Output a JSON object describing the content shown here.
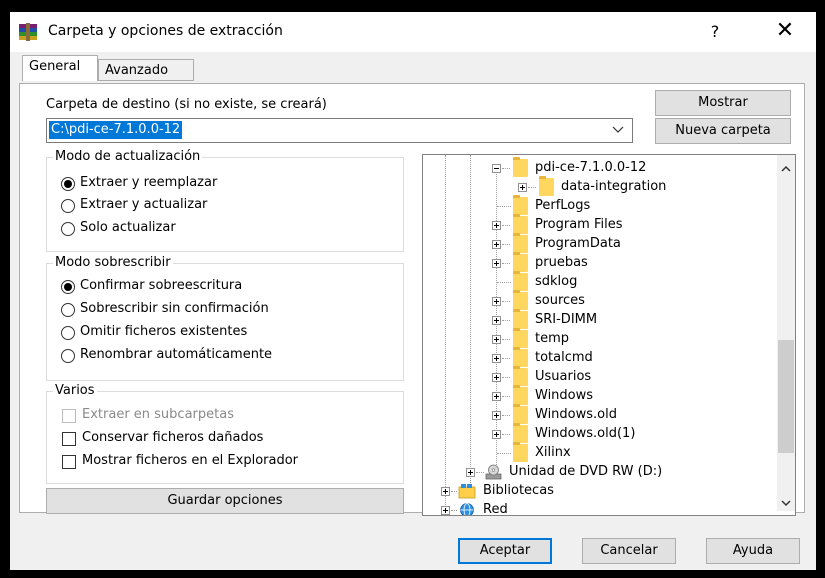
{
  "window": {
    "title": "Carpeta y opciones de extracción",
    "help_label": "?",
    "close_label": "✕"
  },
  "tabs": [
    {
      "label": "General",
      "active": true
    },
    {
      "label": "Avanzado",
      "active": false
    }
  ],
  "destination": {
    "label": "Carpeta de destino (si no existe, se creará)",
    "value": "C:\\pdi-ce-7.1.0.0-12",
    "show_button": "Mostrar",
    "new_folder_button": "Nueva carpeta"
  },
  "update_mode": {
    "title": "Modo de actualización",
    "options": [
      {
        "label": "Extraer y reemplazar",
        "checked": true
      },
      {
        "label": "Extraer y actualizar",
        "checked": false
      },
      {
        "label": "Solo actualizar",
        "checked": false
      }
    ]
  },
  "overwrite_mode": {
    "title": "Modo sobrescribir",
    "options": [
      {
        "label": "Confirmar sobreescritura",
        "checked": true
      },
      {
        "label": "Sobrescribir sin confirmación",
        "checked": false
      },
      {
        "label": "Omitir ficheros existentes",
        "checked": false
      },
      {
        "label": "Renombrar automáticamente",
        "checked": false
      }
    ]
  },
  "misc": {
    "title": "Varios",
    "options": [
      {
        "label": "Extraer en subcarpetas",
        "checked": false,
        "disabled": true
      },
      {
        "label": "Conservar ficheros dañados",
        "checked": false,
        "disabled": false
      },
      {
        "label": "Mostrar ficheros en el Explorador",
        "checked": false,
        "disabled": false
      }
    ]
  },
  "save_options_button": "Guardar opciones",
  "tree": {
    "items": [
      {
        "label": "pdi-ce-7.1.0.0-12",
        "expander": "minus",
        "icon": "folder-open-icon"
      },
      {
        "label": "data-integration",
        "expander": "plus",
        "icon": "folder-icon"
      },
      {
        "label": "PerfLogs",
        "expander": "none",
        "icon": "folder-icon"
      },
      {
        "label": "Program Files",
        "expander": "plus",
        "icon": "folder-icon"
      },
      {
        "label": "ProgramData",
        "expander": "plus",
        "icon": "folder-icon"
      },
      {
        "label": "pruebas",
        "expander": "plus",
        "icon": "folder-icon"
      },
      {
        "label": "sdklog",
        "expander": "none",
        "icon": "folder-icon"
      },
      {
        "label": "sources",
        "expander": "plus",
        "icon": "folder-icon"
      },
      {
        "label": "SRI-DIMM",
        "expander": "plus",
        "icon": "folder-icon"
      },
      {
        "label": "temp",
        "expander": "plus",
        "icon": "folder-icon"
      },
      {
        "label": "totalcmd",
        "expander": "plus",
        "icon": "folder-icon"
      },
      {
        "label": "Usuarios",
        "expander": "plus",
        "icon": "folder-icon"
      },
      {
        "label": "Windows",
        "expander": "plus",
        "icon": "folder-icon"
      },
      {
        "label": "Windows.old",
        "expander": "plus",
        "icon": "folder-icon"
      },
      {
        "label": "Windows.old(1)",
        "expander": "plus",
        "icon": "folder-icon"
      },
      {
        "label": "Xilinx",
        "expander": "none",
        "icon": "folder-icon"
      },
      {
        "label": "Unidad de DVD RW (D:)",
        "expander": "plus",
        "icon": "dvd-drive-icon"
      },
      {
        "label": "Bibliotecas",
        "expander": "plus",
        "icon": "libraries-icon"
      },
      {
        "label": "Red",
        "expander": "plus",
        "icon": "network-icon"
      }
    ]
  },
  "footer": {
    "ok_button": "Aceptar",
    "cancel_button": "Cancelar",
    "help_button": "Ayuda"
  },
  "colors": {
    "accent": "#0078d7",
    "folder": "#ffd75e",
    "window_bg": "#f0f0f0"
  }
}
